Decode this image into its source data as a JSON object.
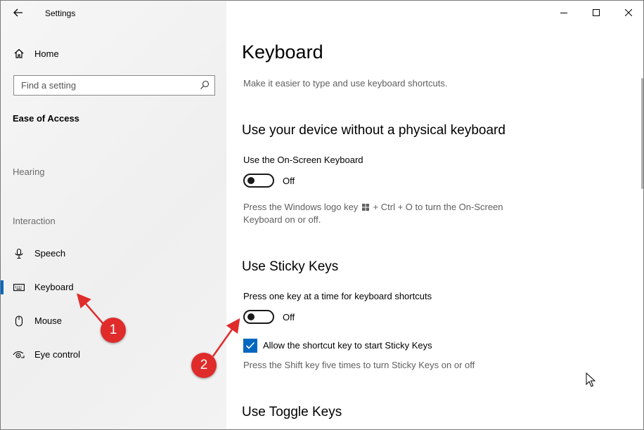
{
  "window": {
    "title": "Settings"
  },
  "sidebar": {
    "home_label": "Home",
    "search": {
      "placeholder": "Find a setting",
      "value": ""
    },
    "section_heading": "Ease of Access",
    "groups": {
      "hearing": "Hearing",
      "interaction": "Interaction"
    },
    "items": [
      {
        "label": "Speech",
        "icon": "microphone-icon"
      },
      {
        "label": "Keyboard",
        "icon": "keyboard-icon",
        "active": true
      },
      {
        "label": "Mouse",
        "icon": "mouse-icon"
      },
      {
        "label": "Eye control",
        "icon": "eye-control-icon"
      }
    ]
  },
  "main": {
    "title": "Keyboard",
    "description": "Make it easier to type and use keyboard shortcuts.",
    "osk": {
      "heading": "Use your device without a physical keyboard",
      "label": "Use the On-Screen Keyboard",
      "state": "Off",
      "helper_a": "Press the Windows logo key",
      "helper_b": "+ Ctrl + O to turn the On-Screen",
      "helper_c": "Keyboard on or off."
    },
    "sticky": {
      "heading": "Use Sticky Keys",
      "label": "Press one key at a time for keyboard shortcuts",
      "state": "Off",
      "checkbox_label": "Allow the shortcut key to start Sticky Keys",
      "checkbox_checked": true,
      "helper": "Press the Shift key five times to turn Sticky Keys on or off"
    },
    "toggle_keys": {
      "heading": "Use Toggle Keys"
    }
  },
  "annotations": {
    "badge1": "1",
    "badge2": "2",
    "color": "#e02b2b"
  },
  "colors": {
    "accent": "#0067c0",
    "sidebar_bg": "#f2f2f2"
  }
}
